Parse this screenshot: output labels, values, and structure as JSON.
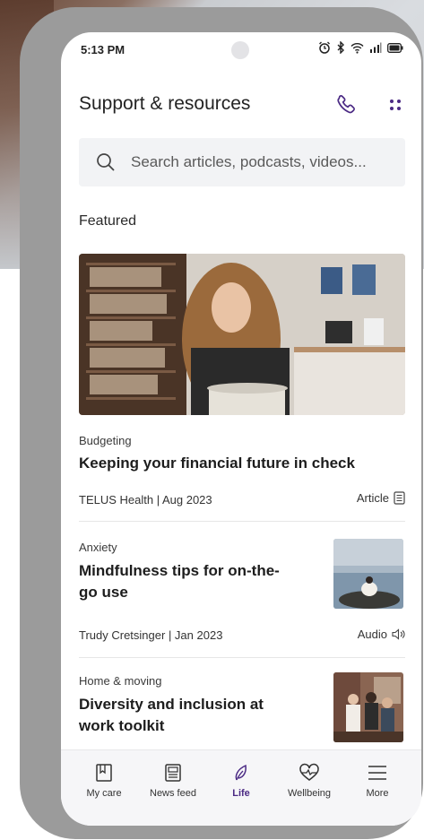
{
  "status_bar": {
    "time": "5:13 PM"
  },
  "header": {
    "title": "Support & resources"
  },
  "search": {
    "placeholder": "Search articles, podcasts, videos..."
  },
  "section": {
    "featured_label": "Featured"
  },
  "articles": [
    {
      "category": "Budgeting",
      "title": "Keeping your financial future in check",
      "meta": "TELUS Health | Aug 2023",
      "type": "Article"
    },
    {
      "category": "Anxiety",
      "title_line1": "Mindfulness tips for on-the-",
      "title_line2": "go use",
      "meta": "Trudy Cretsinger | Jan 2023",
      "type": "Audio"
    },
    {
      "category": "Home & moving",
      "title_line1": "Diversity and inclusion at",
      "title_line2": "work toolkit"
    }
  ],
  "tabs": [
    {
      "label": "My care",
      "icon": "book-icon"
    },
    {
      "label": "News feed",
      "icon": "newspaper-icon"
    },
    {
      "label": "Life",
      "icon": "leaf-icon",
      "active": true
    },
    {
      "label": "Wellbeing",
      "icon": "heart-pulse-icon"
    },
    {
      "label": "More",
      "icon": "menu-icon"
    }
  ],
  "colors": {
    "accent": "#4b2a84",
    "search_bg": "#f2f3f5",
    "frame": "#9b9b9b"
  }
}
